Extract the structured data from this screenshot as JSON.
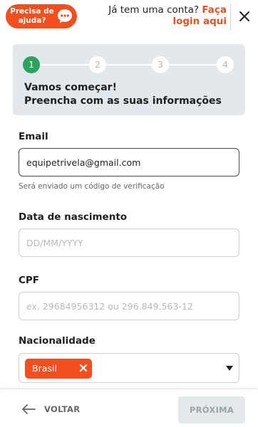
{
  "header": {
    "help_label": "Precisa de ajuda?",
    "login_question": "Já tem uma conta?",
    "login_link_line1": "Faça",
    "login_link_line2": "login aqui"
  },
  "steps": {
    "items": [
      "1",
      "2",
      "3",
      "4"
    ],
    "current": 1,
    "title_line1": "Vamos começar!",
    "title_line2": "Preencha com as suas informações"
  },
  "form": {
    "email": {
      "label": "Email",
      "value": "equipetrivela@gmail.com",
      "hint": "Será enviado um código de verificação"
    },
    "birthdate": {
      "label": "Data de nascimento",
      "placeholder": "DD/MM/YYYY"
    },
    "cpf": {
      "label": "CPF",
      "placeholder": "ex. 29684956312 ou 296.849.563-12"
    },
    "nationality": {
      "label": "Nacionalidade",
      "selected": "Brasil"
    }
  },
  "footer": {
    "back_label": "VOLTAR",
    "next_label": "PRÓXIMA"
  },
  "colors": {
    "brand_orange": "#f24e1e",
    "step_active": "#2ba45b",
    "panel_bg": "#e2e8ec"
  }
}
